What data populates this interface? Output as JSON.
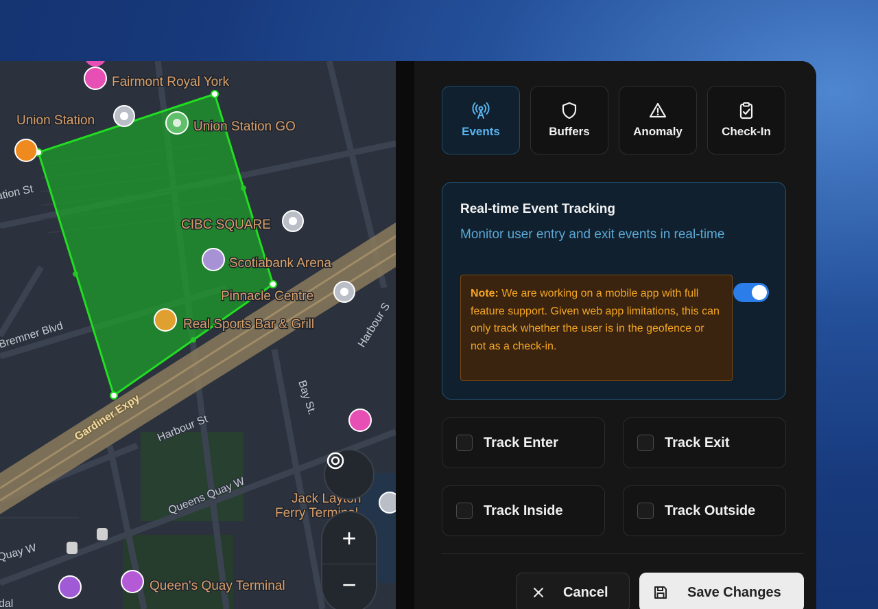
{
  "tabs": [
    {
      "label": "Events",
      "icon": "broadcast-icon",
      "active": true
    },
    {
      "label": "Buffers",
      "icon": "shield-icon",
      "active": false
    },
    {
      "label": "Anomaly",
      "icon": "warning-icon",
      "active": false
    },
    {
      "label": "Check-In",
      "icon": "clipboard-check-icon",
      "active": false
    }
  ],
  "event_tracking": {
    "title": "Real-time Event Tracking",
    "description": "Monitor user entry and exit events in real-time",
    "note_label": "Note:",
    "note_text": " We are working on a mobile app with full feature support. Given web app limitations, this can only track whether the user is in the geofence or not as a check-in.",
    "enabled": true
  },
  "options": [
    {
      "label": "Track Enter",
      "checked": false
    },
    {
      "label": "Track Exit",
      "checked": false
    },
    {
      "label": "Track Inside",
      "checked": false
    },
    {
      "label": "Track Outside",
      "checked": false
    }
  ],
  "actions": {
    "cancel_label": "Cancel",
    "save_label": "Save Changes"
  },
  "map": {
    "places": [
      "Fairmont Royal York",
      "Union Station",
      "Union Station GO",
      "CIBC SQUARE",
      "Scotiabank Arena",
      "Pinnacle Centre",
      "Real Sports Bar & Grill",
      "Jack Layton",
      "Ferry Terminal",
      "Queen's Quay Terminal"
    ],
    "streets": [
      "ation St",
      "Bremner Blvd",
      "Gardiner Expy",
      "Harbour St",
      "Bay St.",
      "Queens Quay W",
      "Quay W",
      "Harbour S",
      "dal"
    ],
    "controls": {
      "locate": "+",
      "zoom_in": "+",
      "zoom_out": "−"
    },
    "colors": {
      "geofence": "#22cc22",
      "expressway": "#8a7a5c",
      "label": "#d9a06b"
    }
  }
}
